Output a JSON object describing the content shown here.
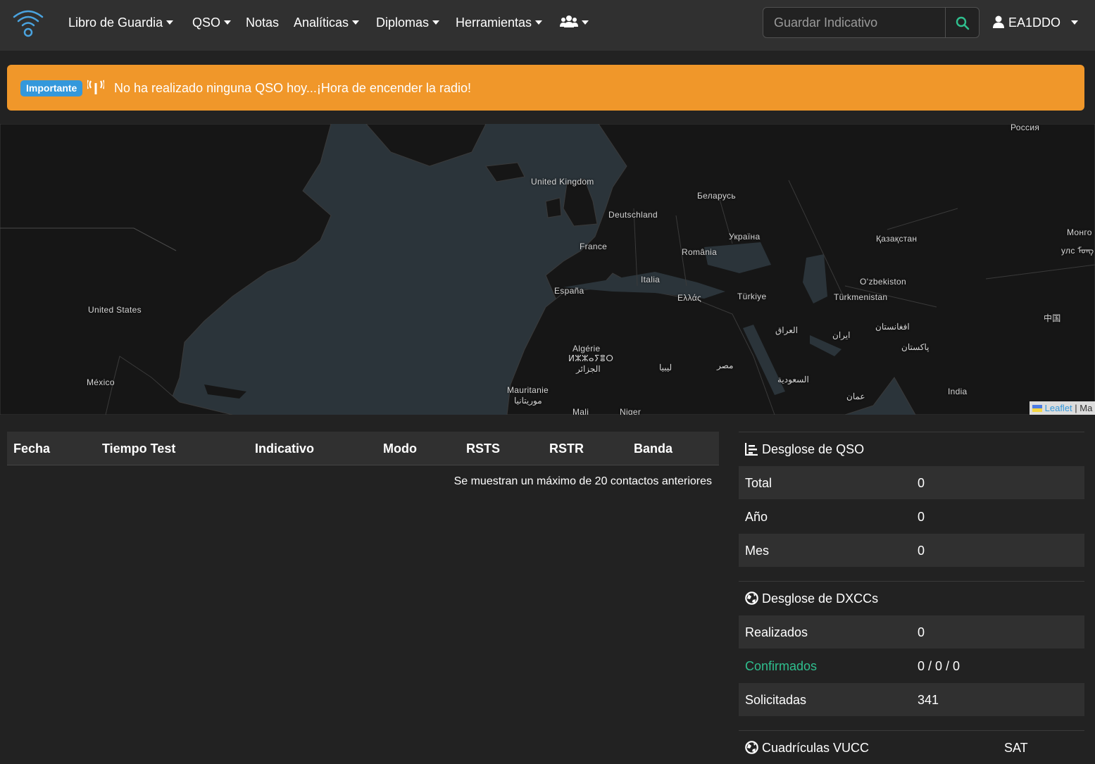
{
  "navbar": {
    "brand": "wifi-logo-icon",
    "items": [
      {
        "label": "Libro de Guardia",
        "dropdown": true
      },
      {
        "label": "QSO",
        "dropdown": true
      },
      {
        "label": "Notas",
        "dropdown": false
      },
      {
        "label": "Analíticas",
        "dropdown": true
      },
      {
        "label": "Diplomas",
        "dropdown": true
      },
      {
        "label": "Herramientas",
        "dropdown": true
      }
    ],
    "users_icon": "users-icon",
    "search": {
      "placeholder": "Guardar Indicativo",
      "value": ""
    },
    "user": {
      "label": "EA1DDO",
      "icon": "user-icon"
    }
  },
  "alert": {
    "badge": "Importante",
    "icon": "antenna-icon",
    "text": "No ha realizado ninguna QSO hoy...¡Hora de encender la radio!"
  },
  "map": {
    "labels": [
      "Россия",
      "United Kingdom",
      "Беларусь",
      "Deutschland",
      "Україна",
      "Қазақстан",
      "Монго",
      "улс ᠮᠣᠩ",
      "France",
      "România",
      "Oʻzbekiston",
      "España",
      "Italia",
      "Ελλάς",
      "Türkiye",
      "Türkmenistan",
      "中国",
      "United States",
      "العراق",
      "افغانستان",
      "ایران",
      "پاکستان",
      "Algérie",
      "ⵍⵣⵣⴰⵢⴻⵔ",
      "الجزائر",
      "ليبيا",
      "مصر",
      "السعودية",
      "México",
      "Mauritanie",
      "موريتانيا",
      "عمان",
      "India",
      "Mali",
      "Niger"
    ],
    "attribution": {
      "link": "Leaflet",
      "rest": "| Ma"
    }
  },
  "qso_table": {
    "columns": [
      "Fecha",
      "Tiempo Test",
      "Indicativo",
      "Modo",
      "RSTS",
      "RSTR",
      "Banda"
    ],
    "rows": [],
    "note": "Se muestran un máximo de 20 contactos anteriores"
  },
  "qso_breakdown": {
    "title": "Desglose de QSO",
    "icon": "chart-icon",
    "rows": [
      {
        "label": "Total",
        "value": "0"
      },
      {
        "label": "Año",
        "value": "0"
      },
      {
        "label": "Mes",
        "value": "0"
      }
    ]
  },
  "dxcc_breakdown": {
    "title": "Desglose de DXCCs",
    "icon": "globe-icon",
    "rows": [
      {
        "label": "Realizados",
        "value": "0"
      },
      {
        "label": "Confirmados",
        "value": "0 / 0 / 0"
      },
      {
        "label": "Solicitadas",
        "value": "341"
      }
    ]
  },
  "vucc": {
    "title": "Cuadrículas VUCC",
    "icon": "globe-icon",
    "col": "SAT"
  },
  "colors": {
    "navbar_bg": "#303030",
    "page_bg": "#222222",
    "alert_bg": "#f0972a",
    "badge_bg": "#3498db",
    "accent": "#2fbf8e",
    "map_water": "#2b343a",
    "map_land": "#161616"
  }
}
